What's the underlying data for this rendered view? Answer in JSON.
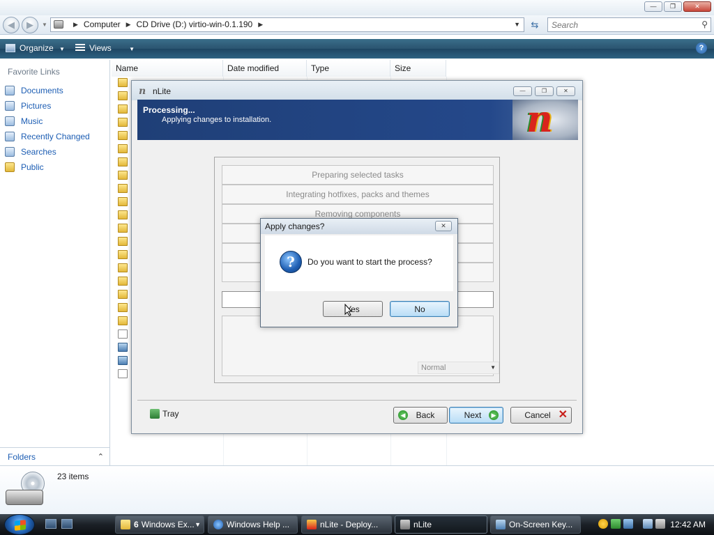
{
  "explorer": {
    "breadcrumbs": [
      "Computer",
      "CD Drive (D:) virtio-win-0.1.190"
    ],
    "search_placeholder": "Search",
    "toolbar": {
      "organize": "Organize",
      "views": "Views"
    },
    "favorites_title": "Favorite Links",
    "favorites": [
      "Documents",
      "Pictures",
      "Music",
      "Recently Changed",
      "Searches",
      "Public"
    ],
    "folders_label": "Folders",
    "columns": [
      "Name",
      "Date modified",
      "Type",
      "Size"
    ],
    "status": "23 items"
  },
  "nlite": {
    "title": "nLite",
    "heading": "Processing...",
    "subheading": "Applying changes to installation.",
    "tasks": [
      "Preparing selected tasks",
      "Integrating hotfixes, packs and themes",
      "Removing components"
    ],
    "priority": "Normal",
    "tray_label": "Tray",
    "back_label": "Back",
    "next_label": "Next",
    "cancel_label": "Cancel"
  },
  "dialog": {
    "title": "Apply changes?",
    "message": "Do you want to start the process?",
    "yes_label": "Yes",
    "no_label": "No"
  },
  "taskbar": {
    "buttons": [
      {
        "count": "6",
        "label": "Windows Ex..."
      },
      {
        "label": "Windows Help ..."
      },
      {
        "label": "nLite - Deploy..."
      },
      {
        "label": "nLite"
      },
      {
        "label": "On-Screen Key..."
      }
    ],
    "clock": "12:42 AM"
  },
  "colors": {
    "accent_blue": "#1c5db3",
    "nlite_header": "#24488a",
    "cmdbar": "#2a5470"
  },
  "progress_fraction": 0
}
